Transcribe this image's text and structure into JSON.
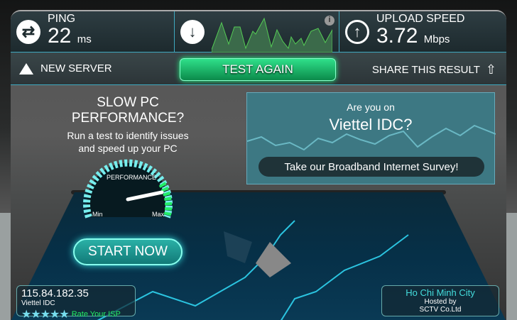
{
  "ping": {
    "label": "PING",
    "value": "22",
    "unit": "ms"
  },
  "upload": {
    "label": "UPLOAD SPEED",
    "value": "3.72",
    "unit": "Mbps"
  },
  "download": {
    "info_icon": "i"
  },
  "actions": {
    "new_server": "NEW SERVER",
    "test_again": "TEST AGAIN",
    "share": "SHARE THIS RESULT"
  },
  "promo": {
    "title": "SLOW PC PERFORMANCE?",
    "line1": "Run a test to identify issues",
    "line2": "and speed up your PC",
    "gauge_label": "PERFORMANCE",
    "min": "Min",
    "max": "Max",
    "start": "START NOW"
  },
  "ad": {
    "question": "Are you on",
    "isp": "Viettel IDC?",
    "survey": "Take our Broadband Internet Survey!"
  },
  "client": {
    "ip": "115.84.182.35",
    "isp": "Viettel IDC",
    "stars": "★★★★★",
    "rate": "Rate Your ISP"
  },
  "server": {
    "city": "Ho Chi Minh City",
    "hosted_by": "Hosted by",
    "host": "SCTV Co.Ltd"
  }
}
